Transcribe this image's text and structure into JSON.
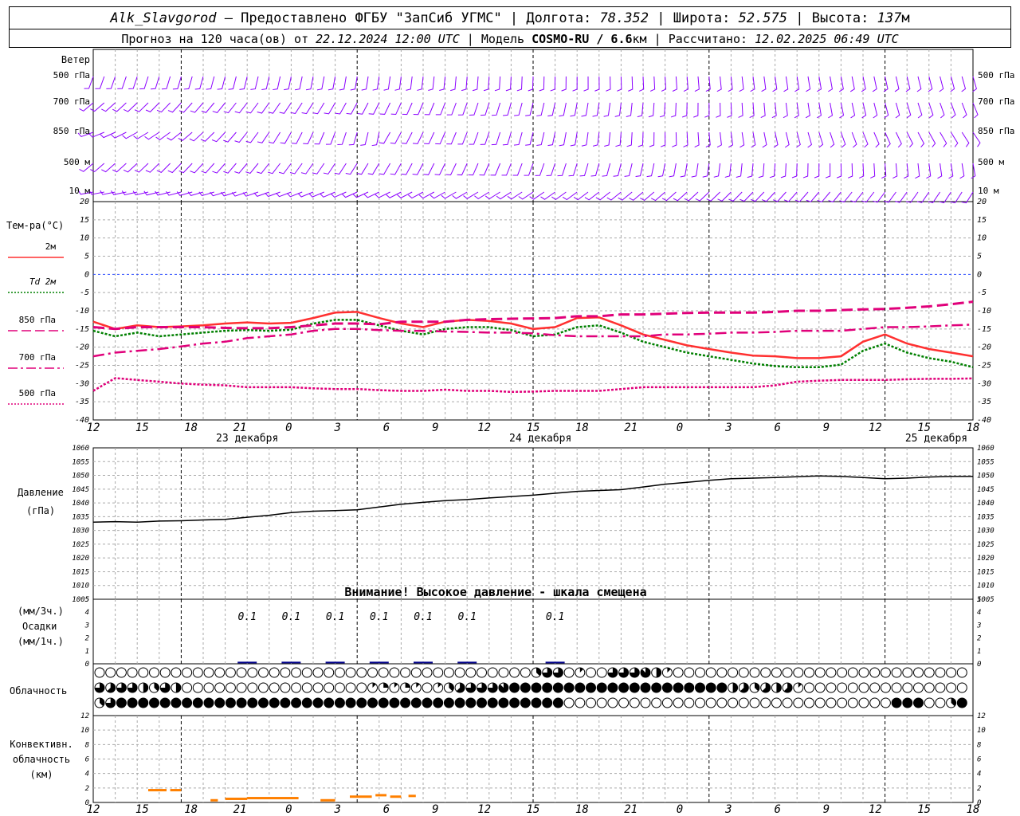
{
  "header": {
    "station": "Alk_Slavgorod",
    "provider": "— Предоставлено ФГБУ \"ЗапСиб УГМС\"",
    "lon_label": "Долгота:",
    "lon": "78.352",
    "lat_label": "Широта:",
    "lat": "52.575",
    "alt_label": "Высота:",
    "alt": "137",
    "alt_unit": "м",
    "forecast_label": "Прогноз на 120 часа(ов) от",
    "forecast_from": "22.12.2024 12:00 UTC",
    "model_label": "Модель",
    "model": "COSMO-RU / 6.6",
    "model_unit": "км",
    "computed_label": "Рассчитано:",
    "computed": "12.02.2025 06:49 UTC"
  },
  "time_axis": {
    "hour_labels": [
      "12",
      "15",
      "18",
      "21",
      "0",
      "3",
      "6",
      "9",
      "12",
      "15",
      "18",
      "21",
      "0",
      "3",
      "6",
      "9",
      "12",
      "15",
      "18"
    ],
    "day_labels": [
      {
        "text": "23 декабря",
        "at_hour": "9"
      },
      {
        "text": "24 декабря",
        "at_hour": "9"
      },
      {
        "text": "25 декабря",
        "at_hour": "9"
      }
    ]
  },
  "wind_panel": {
    "title": "Ветер",
    "levels": [
      "500 гПа",
      "700 гПа",
      "850 гПа",
      "500 м",
      "10  м"
    ],
    "color": "#8b00ff"
  },
  "temp_panel": {
    "title": "Тем-ра(°C)",
    "legend": [
      {
        "label": "2м",
        "color": "#ff3030",
        "style": "solid"
      },
      {
        "label": "Td  2м",
        "color": "#008000",
        "style": "dotted"
      },
      {
        "label": "850 гПа",
        "color": "#e0007a",
        "style": "dashed"
      },
      {
        "label": "700 гПа",
        "color": "#e0007a",
        "style": "dashdot"
      },
      {
        "label": "500 гПа",
        "color": "#e0007a",
        "style": "dotted"
      }
    ]
  },
  "pressure_panel": {
    "title": "Давление",
    "unit": "(гПа)",
    "warning": "Внимание! Высокое давление - шкала смещена"
  },
  "precip_panel": {
    "label_3h": "(мм/3ч.)",
    "title": "Осадки",
    "label_1h": "(мм/1ч.)",
    "amounts": [
      {
        "hour_index": 3,
        "value": "0.1"
      },
      {
        "hour_index": 4,
        "value": "0.1"
      },
      {
        "hour_index": 5,
        "value": "0.1"
      },
      {
        "hour_index": 6,
        "value": "0.1"
      },
      {
        "hour_index": 7,
        "value": "0.1"
      },
      {
        "hour_index": 8,
        "value": "0.1"
      },
      {
        "hour_index": 10,
        "value": "0.1"
      }
    ]
  },
  "cloud_panel": {
    "title": "Облачность"
  },
  "conv_panel": {
    "title_lines": [
      "Конвективн.",
      "облачность",
      "(км)"
    ]
  },
  "chart_data": [
    {
      "type": "line",
      "title": "Тем-ра(°C)",
      "x_hours": [
        0,
        3,
        6,
        9,
        12,
        15,
        18,
        21,
        24,
        27,
        30,
        33,
        36,
        39,
        42,
        45,
        48,
        51,
        54,
        57,
        60,
        63,
        66,
        69,
        72,
        75,
        78,
        81,
        84,
        87,
        90,
        93,
        96,
        99,
        102,
        105,
        108,
        111,
        114,
        117,
        120
      ],
      "ylim": [
        -40,
        20
      ],
      "yticks": [
        -40,
        -35,
        -30,
        -25,
        -20,
        -15,
        -10,
        -5,
        0,
        5,
        10,
        15,
        20
      ],
      "series": [
        {
          "name": "2м",
          "values": [
            -13,
            -15,
            -14,
            -14.5,
            -14.3,
            -14,
            -13.5,
            -13.2,
            -13.5,
            -13.3,
            -12,
            -10.5,
            -10.3,
            -12,
            -13.5,
            -14.5,
            -13,
            -12.5,
            -12.8,
            -13.5,
            -15,
            -14.5,
            -12,
            -11.8,
            -14,
            -16.5,
            -18,
            -19.5,
            -20.5,
            -21.5,
            -22.3,
            -22.5,
            -23,
            -23,
            -22.5,
            -18.5,
            -16.5,
            -19,
            -20.5,
            -21.5,
            -22.5
          ]
        },
        {
          "name": "Td  2м",
          "values": [
            -15.5,
            -17,
            -16,
            -17,
            -16.5,
            -16,
            -15.5,
            -15.3,
            -15.5,
            -15.2,
            -13.5,
            -12.5,
            -12.5,
            -14,
            -15.5,
            -16.5,
            -15,
            -14.5,
            -14.5,
            -15.3,
            -17,
            -16.5,
            -14.5,
            -14,
            -16,
            -18.5,
            -20,
            -21.5,
            -22.5,
            -23.5,
            -24.5,
            -25.2,
            -25.5,
            -25.5,
            -24.8,
            -21,
            -19,
            -21.5,
            -23,
            -24,
            -25.5
          ]
        },
        {
          "name": "850 гПа",
          "values": [
            -14.5,
            -15,
            -14.5,
            -14.5,
            -14.5,
            -14.5,
            -14.7,
            -14.8,
            -14.8,
            -14.5,
            -14,
            -13.5,
            -13.5,
            -13.7,
            -13,
            -13,
            -13,
            -12.5,
            -12.3,
            -12.2,
            -12.1,
            -12,
            -11.5,
            -11.5,
            -11,
            -11,
            -10.8,
            -10.6,
            -10.5,
            -10.5,
            -10.5,
            -10.3,
            -10,
            -10,
            -9.8,
            -9.6,
            -9.5,
            -9.2,
            -8.8,
            -8.2,
            -7.5
          ]
        },
        {
          "name": "700 гПа",
          "values": [
            -22.5,
            -21.5,
            -21,
            -20.5,
            -19.8,
            -19,
            -18.5,
            -17.5,
            -17,
            -16.5,
            -15.5,
            -15,
            -15,
            -15.3,
            -15.5,
            -15.5,
            -15.7,
            -15.8,
            -16,
            -16,
            -16.2,
            -16.7,
            -17,
            -17,
            -17,
            -17,
            -16.5,
            -16.5,
            -16.3,
            -16,
            -16,
            -15.8,
            -15.5,
            -15.5,
            -15.5,
            -15,
            -14.5,
            -14.5,
            -14.3,
            -14,
            -13.8
          ]
        },
        {
          "name": "500 гПа",
          "values": [
            -32,
            -28.5,
            -29,
            -29.5,
            -30,
            -30.3,
            -30.5,
            -31,
            -31,
            -31,
            -31.3,
            -31.5,
            -31.5,
            -31.8,
            -32,
            -32,
            -31.7,
            -32,
            -32,
            -32.3,
            -32.2,
            -32,
            -32,
            -32,
            -31.5,
            -31,
            -31,
            -31,
            -31,
            -31,
            -31,
            -30.5,
            -29.5,
            -29.2,
            -29,
            -29,
            -29,
            -28.8,
            -28.7,
            -28.7,
            -28.6
          ]
        }
      ]
    },
    {
      "type": "line",
      "title": "Давление",
      "x_hours": [
        0,
        3,
        6,
        9,
        12,
        15,
        18,
        21,
        24,
        27,
        30,
        33,
        36,
        39,
        42,
        45,
        48,
        51,
        54,
        57,
        60,
        63,
        66,
        69,
        72,
        75,
        78,
        81,
        84,
        87,
        90,
        93,
        96,
        99,
        102,
        105,
        108,
        111,
        114,
        117,
        120
      ],
      "ylim": [
        1005,
        1060
      ],
      "yticks": [
        1005,
        1010,
        1015,
        1020,
        1025,
        1030,
        1035,
        1040,
        1045,
        1050,
        1055,
        1060
      ],
      "series": [
        {
          "name": "Давление",
          "values": [
            1033,
            1033.2,
            1033,
            1033.4,
            1033.5,
            1033.8,
            1034,
            1034.8,
            1035.5,
            1036.5,
            1037,
            1037.2,
            1037.5,
            1038.5,
            1039.5,
            1040.2,
            1040.8,
            1041.2,
            1041.8,
            1042.3,
            1042.8,
            1043.5,
            1044.2,
            1044.5,
            1044.8,
            1045.8,
            1046.8,
            1047.5,
            1048.2,
            1048.8,
            1049,
            1049.2,
            1049.5,
            1049.8,
            1049.6,
            1049.2,
            1048.8,
            1049,
            1049.4,
            1049.6,
            1049.6
          ]
        }
      ]
    },
    {
      "type": "bar",
      "title": "Осадки",
      "ylim": [
        0,
        5
      ],
      "yticks": [
        0,
        1,
        2,
        3,
        4,
        5
      ],
      "categories": [
        "21",
        "0",
        "3",
        "6",
        "9",
        "12",
        "18"
      ],
      "series": [
        {
          "name": "Осадки",
          "values": [
            0.1,
            0.1,
            0.1,
            0.1,
            0.1,
            0.1,
            0.1
          ]
        }
      ]
    },
    {
      "type": "bar",
      "title": "Конвективн. облачность (км)",
      "ylim": [
        0,
        12
      ],
      "yticks": [
        0,
        2,
        4,
        6,
        8,
        10,
        12
      ],
      "segments": [
        {
          "from_hour": 7.5,
          "to_hour": 10,
          "top_km": 1.7
        },
        {
          "from_hour": 10.5,
          "to_hour": 12,
          "top_km": 1.7
        },
        {
          "from_hour": 16,
          "to_hour": 17,
          "top_km": 0.3
        },
        {
          "from_hour": 18,
          "to_hour": 21,
          "top_km": 0.5
        },
        {
          "from_hour": 21,
          "to_hour": 28,
          "top_km": 0.6
        },
        {
          "from_hour": 31,
          "to_hour": 33,
          "top_km": 0.3
        },
        {
          "from_hour": 35,
          "to_hour": 38,
          "top_km": 0.8
        },
        {
          "from_hour": 38.5,
          "to_hour": 40,
          "top_km": 1.0
        },
        {
          "from_hour": 40.5,
          "to_hour": 42,
          "top_km": 0.8
        },
        {
          "from_hour": 43,
          "to_hour": 44,
          "top_km": 0.9
        }
      ]
    },
    {
      "type": "table",
      "title": "Облачность",
      "rows_oktas": [
        [
          0,
          0,
          0,
          0,
          0,
          0,
          0,
          0,
          0,
          0,
          0,
          0,
          0,
          0,
          0,
          0,
          0,
          0,
          0,
          0,
          0,
          0,
          0,
          0,
          0,
          0,
          0,
          0,
          0,
          0,
          0,
          0,
          0,
          0,
          0,
          0,
          0,
          0,
          0,
          0,
          3,
          6,
          6,
          0,
          1,
          0,
          0,
          6,
          6,
          6,
          7,
          4,
          1,
          0,
          0,
          0,
          0,
          0,
          0,
          0,
          0,
          0,
          0,
          0,
          0,
          0,
          0,
          0,
          0,
          0,
          0,
          0,
          0,
          0,
          0,
          0,
          0,
          0,
          0,
          0,
          0,
          0
        ],
        [
          6,
          5,
          6,
          6,
          4,
          3,
          6,
          4,
          0,
          0,
          0,
          0,
          0,
          0,
          0,
          0,
          0,
          0,
          0,
          0,
          0,
          0,
          0,
          0,
          0,
          1,
          2,
          1,
          2,
          1,
          0,
          1,
          3,
          5,
          6,
          6,
          6,
          7,
          8,
          8,
          8,
          8,
          8,
          8,
          8,
          8,
          8,
          8,
          8,
          8,
          8,
          8,
          8,
          8,
          8,
          8,
          8,
          8,
          4,
          5,
          3,
          5,
          4,
          5,
          1,
          0,
          0,
          0,
          0,
          0,
          0,
          0,
          0,
          0,
          0,
          0,
          0,
          0,
          0,
          0,
          0,
          6,
          1,
          1,
          1,
          1,
          1,
          1,
          1,
          1,
          1,
          1,
          1,
          1,
          1,
          0,
          0,
          0,
          0
        ],
        [
          3,
          6,
          8,
          8,
          8,
          8,
          8,
          8,
          8,
          8,
          8,
          8,
          8,
          8,
          8,
          8,
          8,
          8,
          8,
          8,
          8,
          8,
          8,
          8,
          8,
          8,
          8,
          8,
          8,
          8,
          8,
          8,
          8,
          8,
          8,
          8,
          8,
          8,
          8,
          8,
          8,
          8,
          8,
          0,
          0,
          0,
          0,
          0,
          0,
          0,
          0,
          0,
          0,
          0,
          0,
          0,
          0,
          0,
          0,
          0,
          0,
          0,
          0,
          0,
          0,
          0,
          0,
          0,
          0,
          0,
          0,
          0,
          0,
          8,
          8,
          8,
          0,
          0,
          3,
          8,
          8,
          8,
          1,
          0,
          0,
          0,
          0,
          0,
          0,
          0,
          0,
          0,
          0,
          0,
          0,
          0,
          0,
          0,
          0,
          0,
          0,
          0,
          0
        ]
      ]
    }
  ]
}
